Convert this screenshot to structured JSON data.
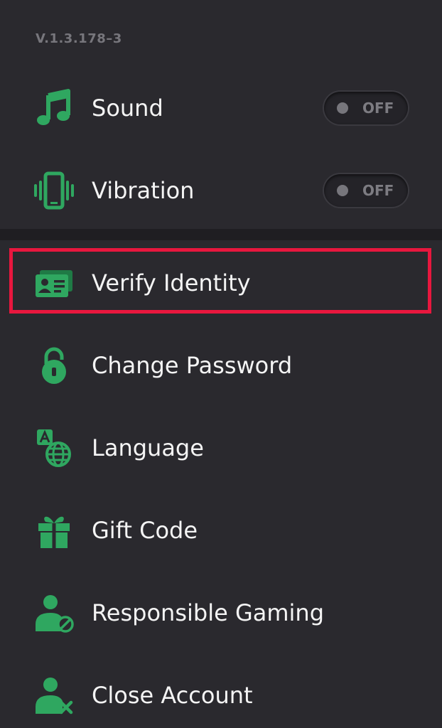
{
  "version": "V.1.3.178–3",
  "colors": {
    "accent": "#2fa760",
    "background": "#2a292e",
    "highlight": "#e8173e"
  },
  "settings": {
    "sound": {
      "label": "Sound",
      "icon": "music-note-icon",
      "toggle_state": "OFF"
    },
    "vibration": {
      "label": "Vibration",
      "icon": "vibration-icon",
      "toggle_state": "OFF"
    }
  },
  "menu": {
    "verify_identity": {
      "label": "Verify Identity",
      "icon": "id-card-icon"
    },
    "change_password": {
      "label": "Change Password",
      "icon": "lock-icon"
    },
    "language": {
      "label": "Language",
      "icon": "globe-language-icon"
    },
    "gift_code": {
      "label": "Gift Code",
      "icon": "gift-icon"
    },
    "responsible_gaming": {
      "label": "Responsible Gaming",
      "icon": "user-block-icon"
    },
    "close_account": {
      "label": "Close Account",
      "icon": "user-remove-icon"
    }
  }
}
